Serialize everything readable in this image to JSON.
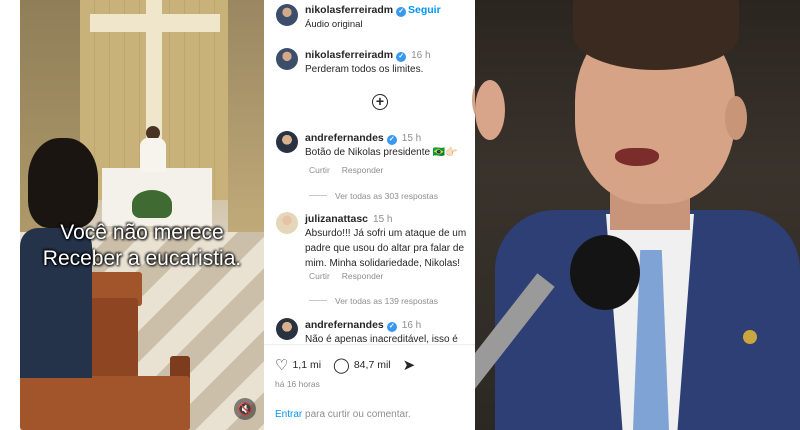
{
  "video": {
    "caption_line1": "Você não merece",
    "caption_line2": "Receber a eucaristia.",
    "mute_icon": "speaker-muted-icon"
  },
  "post": {
    "username": "nikolasferreiradm",
    "follow_label": "Seguir",
    "audio_label": "Áudio original"
  },
  "comments": [
    {
      "username": "nikolasferreiradm",
      "time": "16 h",
      "text": "Perderam todos os limites."
    },
    {
      "username": "andrefernandes",
      "time": "15 h",
      "text": "Botão de Nikolas presidente 🇧🇷👉🏻",
      "like_label": "Curtir",
      "reply_label": "Responder",
      "replies_label": "Ver todas as 303 respostas"
    },
    {
      "username": "julizanattasc",
      "time": "15 h",
      "text": "Absurdo!!! Já sofri um ataque de um padre que usou do altar pra falar de mim. Minha solidariedade, Nikolas!",
      "like_label": "Curtir",
      "reply_label": "Responder",
      "replies_label": "Ver todas as 139 respostas"
    },
    {
      "username": "andrefernandes",
      "time": "16 h",
      "text": "Não é apenas inacreditável, isso é"
    }
  ],
  "actions": {
    "likes": "1,1 mi",
    "comments": "84,7 mil",
    "time_ago": "há 16 horas"
  },
  "login": {
    "link": "Entrar",
    "rest": "para curtir ou comentar."
  },
  "colors": {
    "accent": "#0095f6",
    "verified": "#3897f0",
    "muted_text": "#8e8e8e"
  }
}
